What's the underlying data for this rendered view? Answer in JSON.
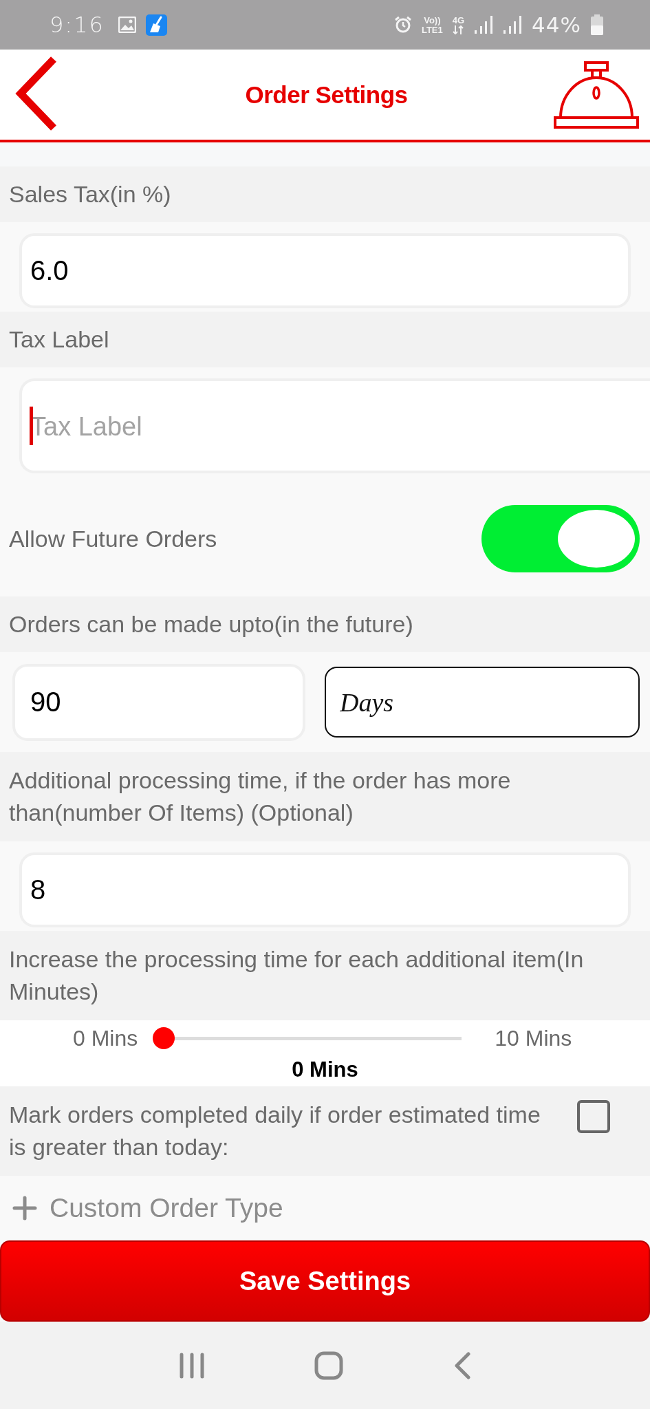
{
  "status_bar": {
    "time": "9:16",
    "volte_top": "Vo))",
    "volte_bottom": "LTE1",
    "network": "4G",
    "battery": "44%"
  },
  "header": {
    "title": "Order Settings"
  },
  "settings": [
    {
      "kind": "text_field",
      "label": "Sales Tax(in %)",
      "value": "6.0",
      "focused": false
    },
    {
      "kind": "text_field",
      "label": "Tax Label",
      "placeholder": "Tax Label",
      "focused": true
    },
    {
      "kind": "switch",
      "label": "Allow Future Orders",
      "on": true
    },
    {
      "kind": "field_pair",
      "label": "Orders can be made upto(in the future)",
      "value": "90",
      "unit": "Days"
    },
    {
      "kind": "text_field",
      "label": "Additional processing time, if the order has more than(number Of Items) (Optional)",
      "value": "8",
      "focused": false
    },
    {
      "kind": "slider",
      "label": "Increase the processing time for each additional item(In Minutes)",
      "min_label": "0 Mins",
      "max_label": "10 Mins",
      "value_label": "0 Mins",
      "level": 0
    },
    {
      "kind": "checkbox",
      "label": "Mark orders completed daily if order estimated time is greater than today:",
      "checked": false
    }
  ],
  "custom_order_type": {
    "label": "Custom Order Type"
  },
  "save_button": {
    "label": "Save Settings"
  }
}
